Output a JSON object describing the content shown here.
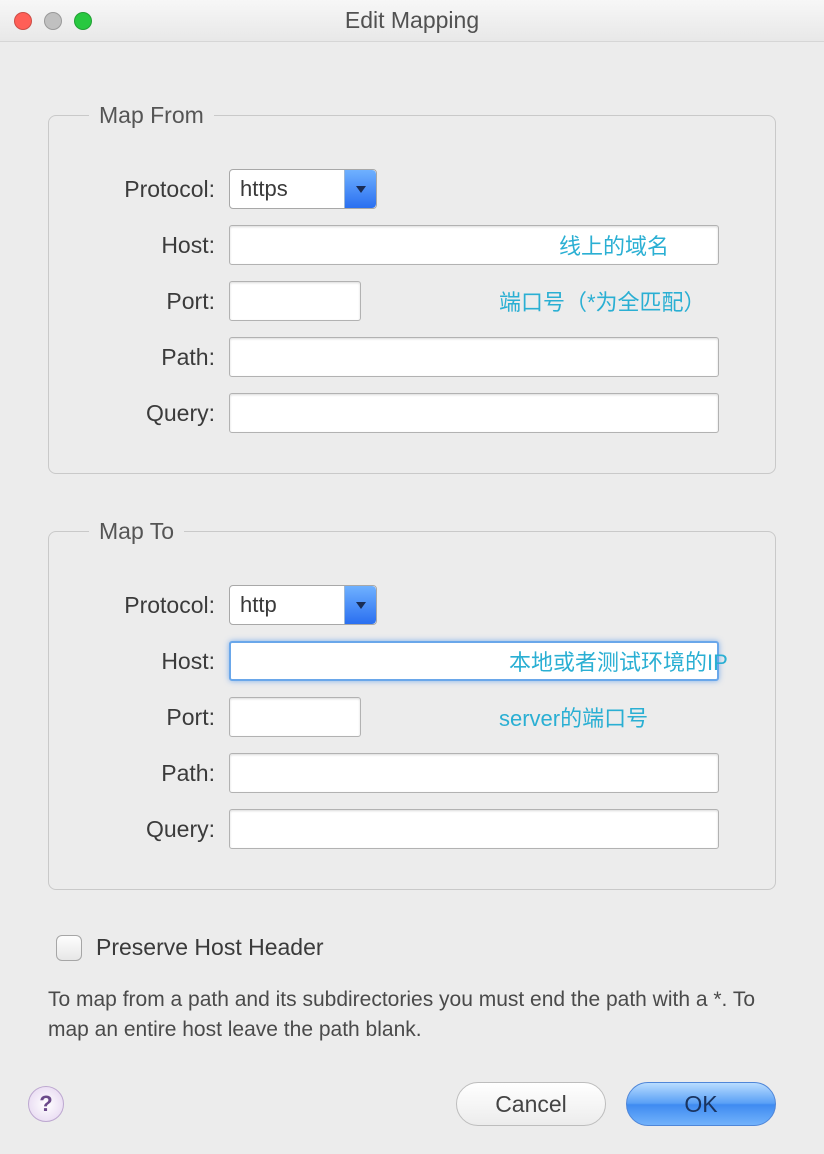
{
  "window": {
    "title": "Edit Mapping"
  },
  "map_from": {
    "legend": "Map From",
    "protocol_label": "Protocol:",
    "protocol_value": "https",
    "host_label": "Host:",
    "host_value": "",
    "host_annotation": "线上的域名",
    "port_label": "Port:",
    "port_value": "",
    "port_annotation": "端口号（*为全匹配）",
    "path_label": "Path:",
    "path_value": "",
    "query_label": "Query:",
    "query_value": ""
  },
  "map_to": {
    "legend": "Map To",
    "protocol_label": "Protocol:",
    "protocol_value": "http",
    "host_label": "Host:",
    "host_value": "",
    "host_annotation": "本地或者测试环境的IP",
    "port_label": "Port:",
    "port_value": "",
    "port_annotation": "server的端口号",
    "path_label": "Path:",
    "path_value": "",
    "query_label": "Query:",
    "query_value": ""
  },
  "preserve_host": {
    "label": "Preserve Host Header",
    "checked": false
  },
  "help_text": "To map from a path and its subdirectories you must end the path with a *. To map an entire host leave the path blank.",
  "buttons": {
    "help": "?",
    "cancel": "Cancel",
    "ok": "OK"
  }
}
